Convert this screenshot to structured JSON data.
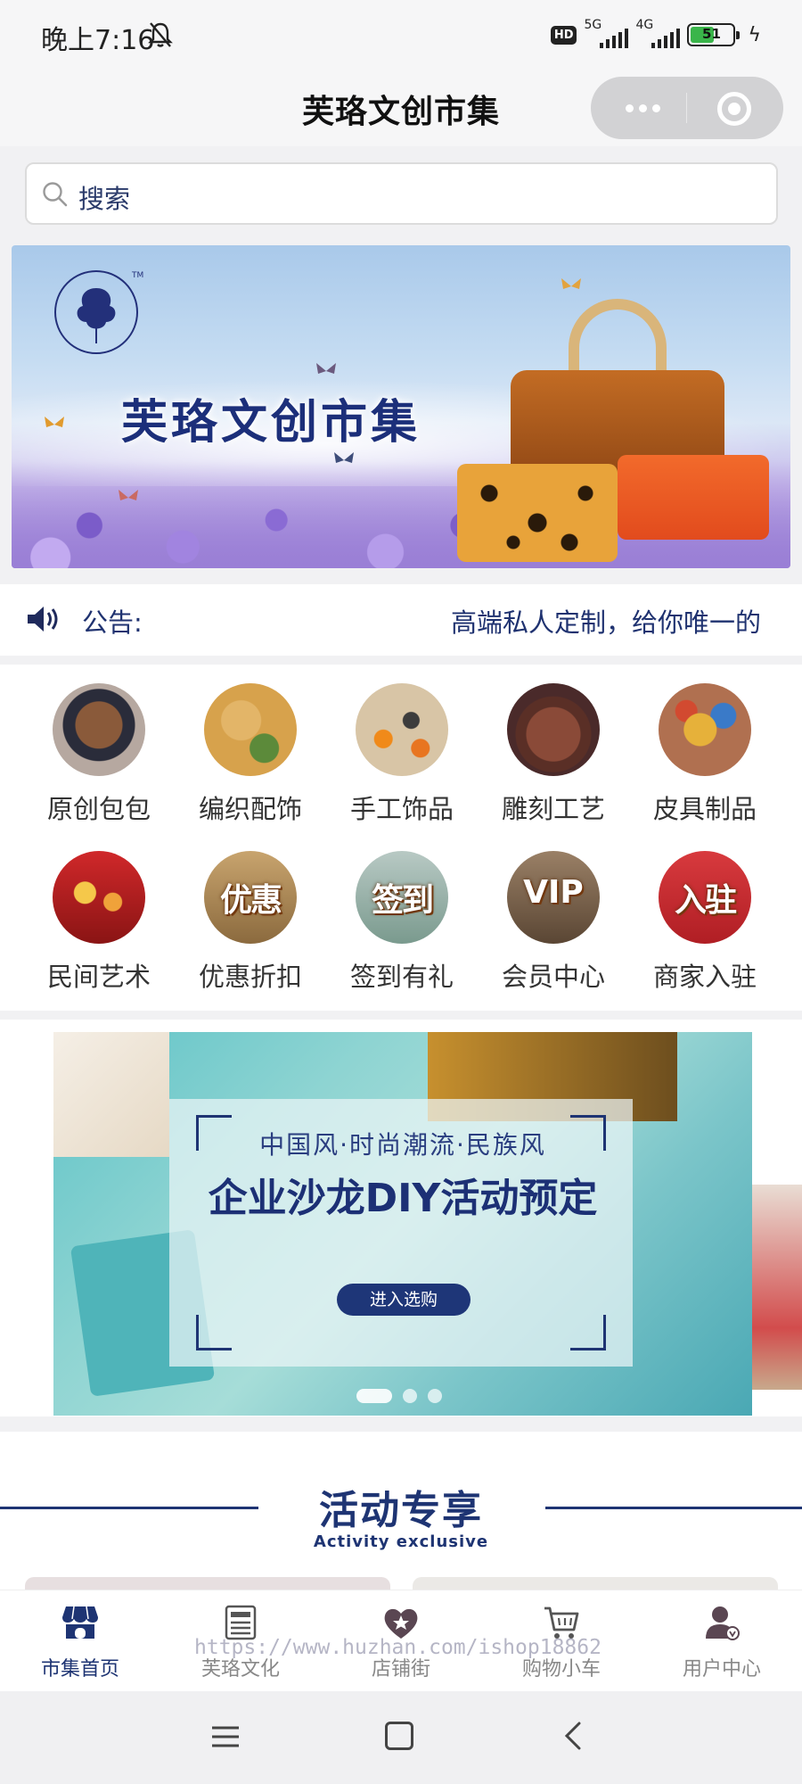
{
  "status_bar": {
    "time": "晚上7:16",
    "hd": "HD",
    "signal1": "5G",
    "signal2": "4G",
    "battery": "51"
  },
  "header": {
    "title": "芙珞文创市集"
  },
  "search": {
    "placeholder": "搜索"
  },
  "hero": {
    "title": "芙珞文创市集"
  },
  "notice": {
    "label": "公告:",
    "text": "高端私人定制，给你唯一的"
  },
  "categories": [
    {
      "label": "原创包包",
      "icon": "bear-bag-image"
    },
    {
      "label": "编织配饰",
      "icon": "knit-accessory-image"
    },
    {
      "label": "手工饰品",
      "icon": "handmade-jewelry-image"
    },
    {
      "label": "雕刻工艺",
      "icon": "carving-image"
    },
    {
      "label": "皮具制品",
      "icon": "leather-goods-image"
    },
    {
      "label": "民间艺术",
      "icon": "folk-art-image",
      "overlay": ""
    },
    {
      "label": "优惠折扣",
      "icon": "discount-image",
      "overlay": "优惠"
    },
    {
      "label": "签到有礼",
      "icon": "checkin-image",
      "overlay": "签到"
    },
    {
      "label": "会员中心",
      "icon": "vip-image",
      "overlay": "VIP"
    },
    {
      "label": "商家入驻",
      "icon": "merchant-image",
      "overlay": "入驻"
    }
  ],
  "activity_banner": {
    "subtitle": "中国风·时尚潮流·民族风",
    "title": "企业沙龙DIY活动预定",
    "button": "进入选购",
    "slide_count": 3,
    "active_slide": 1
  },
  "section": {
    "title": "活动专享",
    "subtitle": "Activity exclusive"
  },
  "tabbar": {
    "items": [
      {
        "label": "市集首页",
        "icon": "shop-icon",
        "active": true
      },
      {
        "label": "芙珞文化",
        "icon": "document-icon",
        "active": false
      },
      {
        "label": "店铺街",
        "icon": "heart-star-icon",
        "active": false
      },
      {
        "label": "购物小车",
        "icon": "cart-icon",
        "active": false
      },
      {
        "label": "用户中心",
        "icon": "user-icon",
        "active": false
      }
    ]
  },
  "watermark": "https://www.huzhan.com/ishop18862",
  "colors": {
    "brand": "#1e3473",
    "tab_active": "#1e3473",
    "tab_inactive": "#888888"
  }
}
